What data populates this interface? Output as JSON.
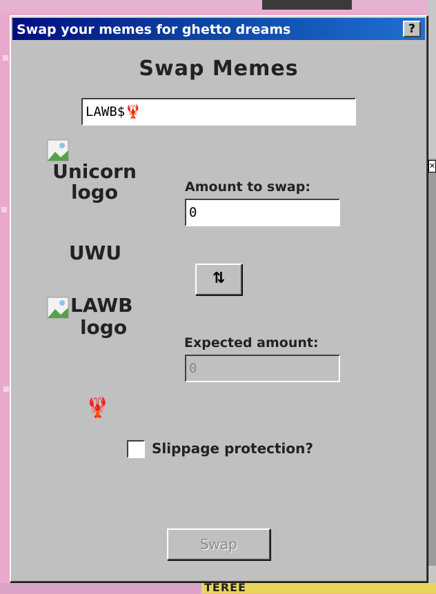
{
  "window": {
    "title": "Swap your memes for ghetto dreams",
    "help_label": "?"
  },
  "heading": "Swap Memes",
  "token_input": {
    "value": "LAWB$🦞"
  },
  "from_token": {
    "logo_alt_line1": "Unicorn",
    "logo_alt_line2": "logo",
    "symbol": "UWU"
  },
  "to_token": {
    "logo_alt_line1": "LAWB",
    "logo_alt_line2": "logo",
    "emoji": "🦞"
  },
  "amount": {
    "label": "Amount to swap:",
    "value": "0"
  },
  "swap_direction_label": "⇅",
  "expected": {
    "label": "Expected amount:",
    "value": "0"
  },
  "slippage": {
    "label": "Slippage protection?",
    "checked": false
  },
  "swap_button_label": "Swap",
  "background": {
    "bottom_text": "TEREE"
  }
}
